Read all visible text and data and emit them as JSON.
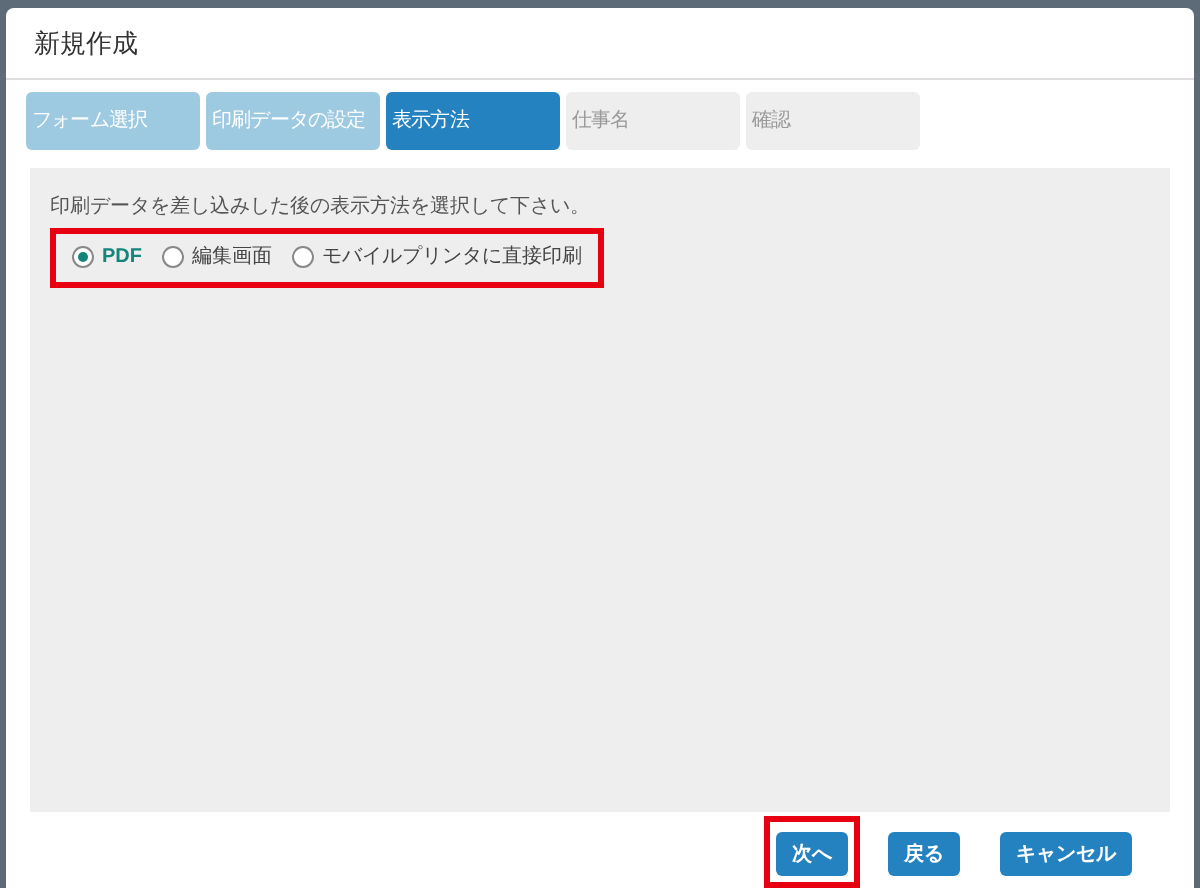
{
  "dialog": {
    "title": "新規作成"
  },
  "steps": [
    {
      "label": "フォーム選択",
      "kind": "done"
    },
    {
      "label": "印刷データの設定",
      "kind": "done"
    },
    {
      "label": "表示方法",
      "kind": "current"
    },
    {
      "label": "仕事名",
      "kind": "todo"
    },
    {
      "label": "確認",
      "kind": "todo"
    }
  ],
  "panel": {
    "instruction": "印刷データを差し込みした後の表示方法を選択して下さい。",
    "highlighted": true,
    "options": [
      {
        "label": "PDF",
        "selected": true
      },
      {
        "label": "編集画面",
        "selected": false
      },
      {
        "label": "モバイルプリンタに直接印刷",
        "selected": false
      }
    ]
  },
  "buttons": [
    {
      "label": "次へ",
      "highlighted": true
    },
    {
      "label": "戻る",
      "highlighted": false
    },
    {
      "label": "キャンセル",
      "highlighted": false
    }
  ]
}
